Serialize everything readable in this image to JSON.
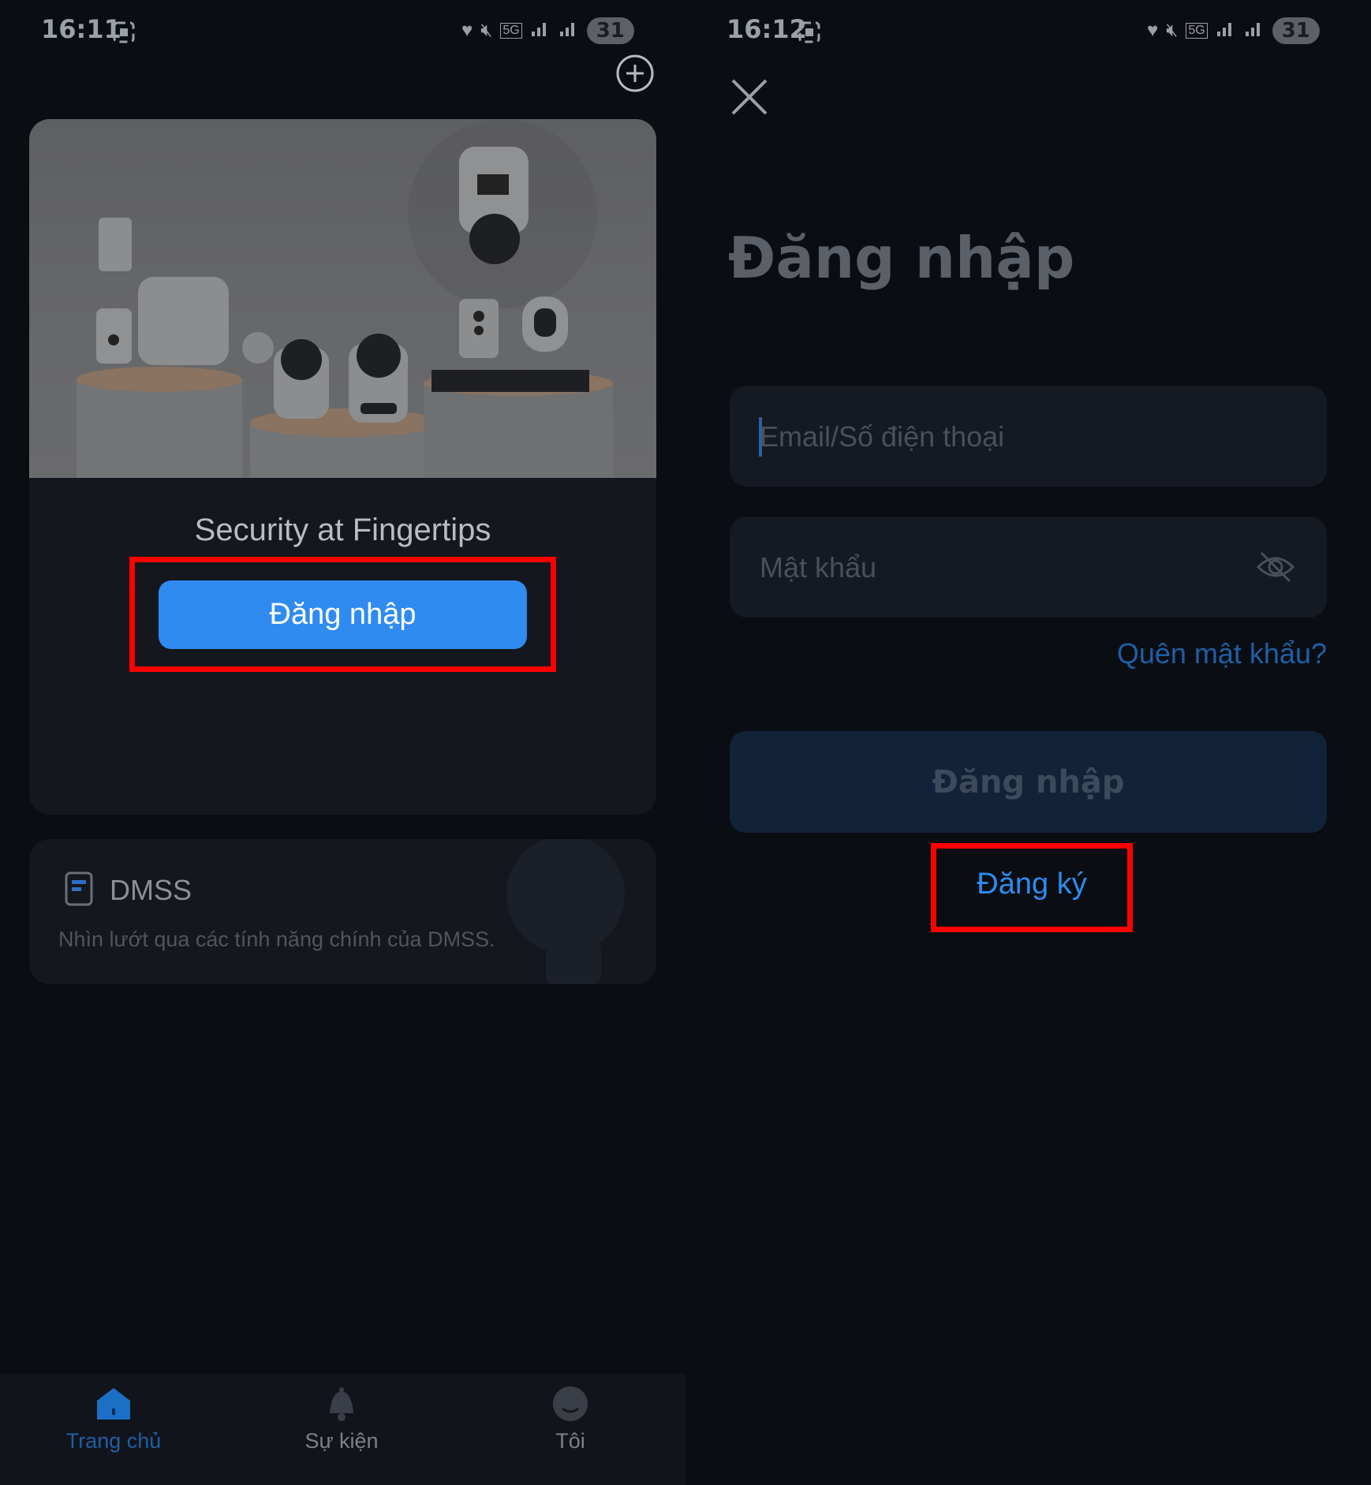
{
  "left": {
    "status": {
      "time": "16:11",
      "battery": "31",
      "network": "5G"
    },
    "card": {
      "tagline": "Security at Fingertips",
      "login_label": "Đăng nhập"
    },
    "dmss": {
      "title": "DMSS",
      "desc": "Nhìn lướt qua các tính năng chính của DMSS."
    },
    "nav": {
      "items": [
        {
          "label": "Trang chủ",
          "icon": "home-icon",
          "active": true
        },
        {
          "label": "Sự kiện",
          "icon": "bell-icon",
          "active": false
        },
        {
          "label": "Tôi",
          "icon": "profile-icon",
          "active": false
        }
      ]
    }
  },
  "right": {
    "status": {
      "time": "16:12",
      "battery": "31",
      "network": "5G"
    },
    "title": "Đăng nhập",
    "email": {
      "placeholder": "Email/Số điện thoại"
    },
    "password": {
      "placeholder": "Mật khẩu"
    },
    "forgot_label": "Quên mật khẩu?",
    "login_label": "Đăng nhập",
    "register_label": "Đăng ký"
  },
  "colors": {
    "accent": "#2f8bf0",
    "highlight": "#ff0000",
    "background": "#0a0d12"
  }
}
